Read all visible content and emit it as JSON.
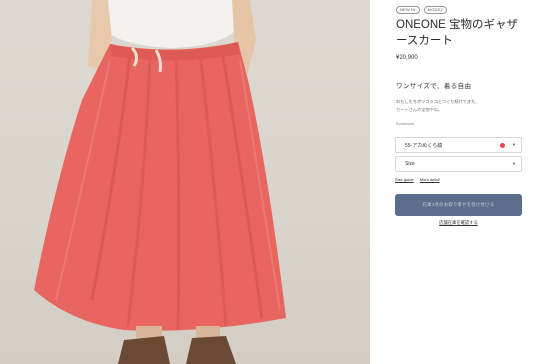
{
  "product": {
    "tags": [
      "NEW IN",
      "MODE2"
    ],
    "title": "ONEONE 宝物のギャザースカート",
    "price": "¥20,900",
    "tagline": "ワンサイズで、着る自由",
    "description_line1": "わたしたちボツコツコとつくり続けてきた、",
    "description_line2": "カートさんの宝物やね。",
    "bookmark": "Bookmark"
  },
  "options": {
    "color": {
      "selected": "55-アカめくら縞",
      "swatch_color": "#e24a4a"
    },
    "size": {
      "selected": "Size"
    }
  },
  "links": {
    "size_guide": "Size guide",
    "more_detail": "More detail"
  },
  "actions": {
    "add_to_cart": "在庫1点のお取り寄せを受け付ける",
    "store_stock": "店舗在庫を確認する"
  },
  "colors": {
    "skirt": "#e8665f",
    "button": "#5b6e8b"
  }
}
